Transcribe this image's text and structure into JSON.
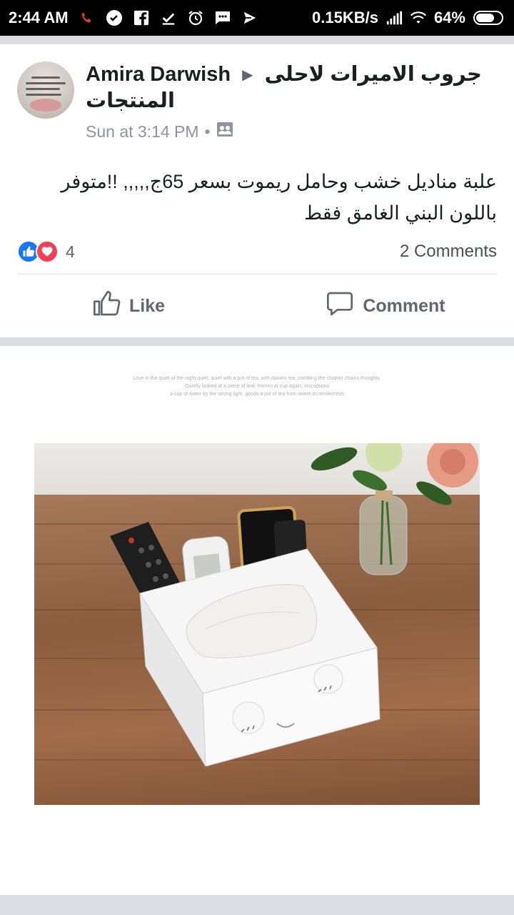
{
  "status_bar": {
    "time": "2:44 AM",
    "network_speed": "0.15KB/s",
    "battery": "64%"
  },
  "post": {
    "author": "Amira Darwish",
    "group": "جروب الاميرات لاحلى المنتجات",
    "timestamp": "Sun at 3:14 PM",
    "separator": "•",
    "privacy_icon": "group-icon",
    "text": "علبة مناديل خشب وحامل ريموت بسعر 65ج,,,,, !!متوفر باللون البني الغامق فقط",
    "reaction_count": "4",
    "comments_label": "2 Comments",
    "actions": {
      "like": "Like",
      "comment": "Comment"
    }
  },
  "photo": {
    "caption_lines": [
      "Love in the quiet of the night quiet, quiet with a pot of tea, with daisies tea, combing the chapter chains thoughts.",
      "Quietly looked at a piece of leaf, hmmm at cup again, inscriptions",
      "a cup of water by the strong light, goods a pot of tea from sweet on tenderness"
    ]
  },
  "colors": {
    "accent": "#1877f2",
    "love": "#f33e58",
    "text": "#1c1e21",
    "secondary": "#606770"
  }
}
